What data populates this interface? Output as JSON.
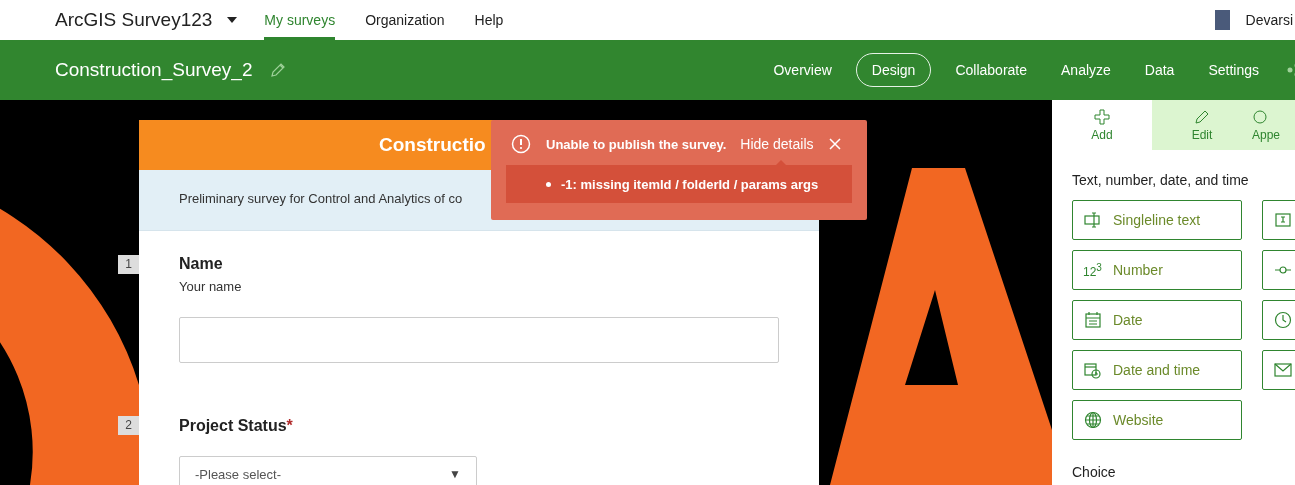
{
  "top_bar": {
    "app_name": "ArcGIS Survey123",
    "nav": [
      {
        "label": "My surveys",
        "selected": true
      },
      {
        "label": "Organization",
        "selected": false
      },
      {
        "label": "Help",
        "selected": false
      }
    ],
    "user_name": "Devarsi"
  },
  "survey_bar": {
    "title": "Construction_Survey_2",
    "tabs": [
      {
        "label": "Overview",
        "selected": false
      },
      {
        "label": "Design",
        "selected": true
      },
      {
        "label": "Collaborate",
        "selected": false
      },
      {
        "label": "Analyze",
        "selected": false
      },
      {
        "label": "Data",
        "selected": false
      },
      {
        "label": "Settings",
        "selected": false
      }
    ]
  },
  "form": {
    "title": "Constructio",
    "description": "Preliminary survey for Control and Analytics of co",
    "questions": [
      {
        "number": "1",
        "label": "Name",
        "hint": "Your name",
        "kind": "text"
      },
      {
        "number": "2",
        "label": "Project Status",
        "required_mark": "*",
        "kind": "select",
        "placeholder": "-Please select-",
        "arrow": "▼"
      }
    ]
  },
  "error_toast": {
    "message": "Unable to publish the survey.",
    "toggle": "Hide details",
    "details": [
      "-1: missing itemId / folderId / params args"
    ]
  },
  "panel": {
    "tabs": [
      {
        "label": "Add",
        "selected": true,
        "kind": "add"
      },
      {
        "label": "Edit",
        "selected": false,
        "kind": "edit"
      },
      {
        "label": "Appe",
        "selected": false,
        "kind": "appearance"
      }
    ],
    "section": "Text, number, date, and time",
    "question_types": [
      {
        "kind": "singleline",
        "label": "Singleline text"
      },
      {
        "kind": "multiline"
      },
      {
        "kind": "number",
        "label": "Number",
        "icon_text": "12$^{3}$"
      },
      {
        "kind": "range"
      },
      {
        "kind": "date",
        "label": "Date"
      },
      {
        "kind": "time"
      },
      {
        "kind": "datetime",
        "label": "Date and time"
      },
      {
        "kind": "email"
      },
      {
        "kind": "website",
        "label": "Website"
      }
    ],
    "next_section": "Choice"
  }
}
